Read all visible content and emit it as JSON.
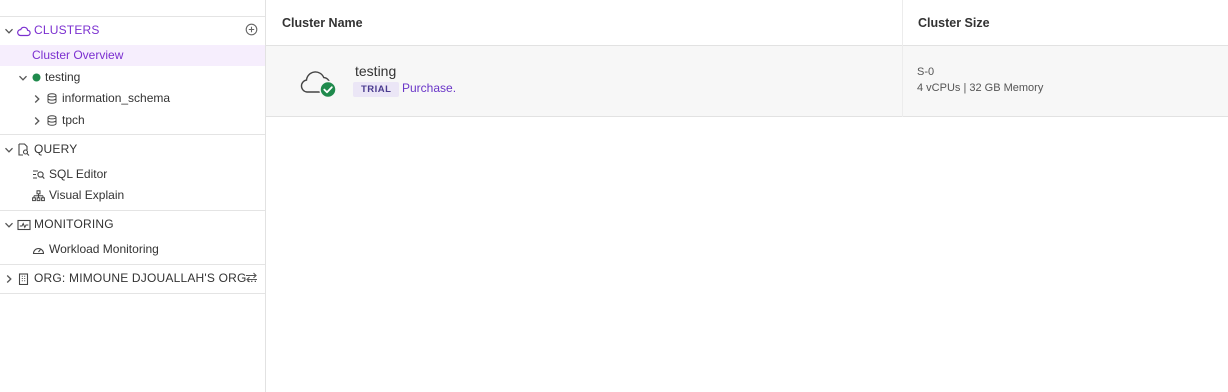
{
  "sidebar": {
    "clusters": {
      "label": "CLUSTERS",
      "items": {
        "overview": "Cluster Overview",
        "cluster": "testing",
        "db1": "information_schema",
        "db2": "tpch"
      }
    },
    "query": {
      "label": "QUERY",
      "items": {
        "sql_editor": "SQL Editor",
        "visual_explain": "Visual Explain"
      }
    },
    "monitoring": {
      "label": "MONITORING",
      "items": {
        "workload": "Workload Monitoring"
      }
    },
    "org": {
      "label": "ORG: MIMOUNE DJOUALLAH'S ORG..."
    }
  },
  "table": {
    "columns": [
      "Cluster Name",
      "Cluster Size"
    ],
    "rows": [
      {
        "name": "testing",
        "badge": "TRIAL",
        "link": "Purchase.",
        "size": "S-0",
        "spec": "4 vCPUs | 32 GB Memory"
      }
    ]
  },
  "colors": {
    "accent": "#7b2fd0",
    "status_ok": "#1f8a4c",
    "selected_bg": "#f6eefd"
  }
}
